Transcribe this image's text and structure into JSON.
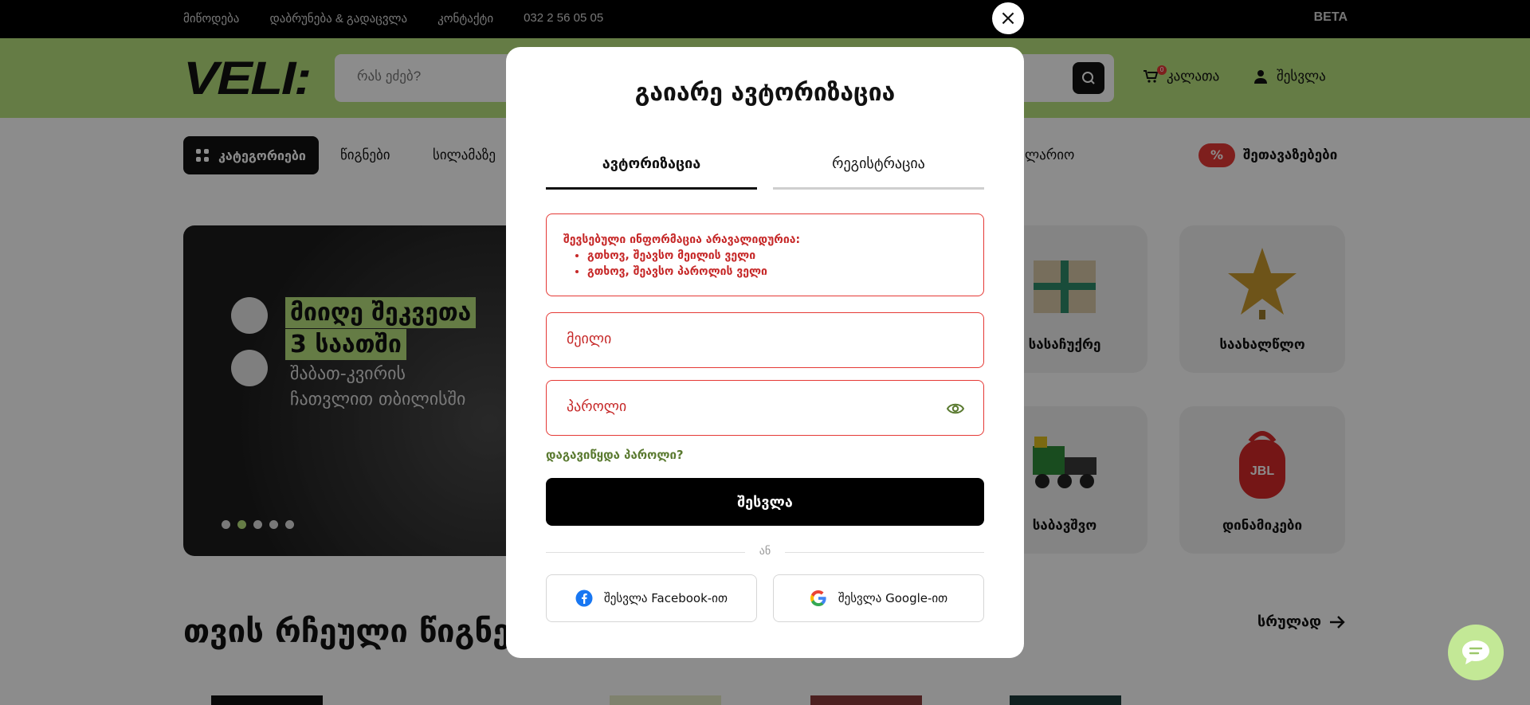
{
  "topbar": {
    "links": [
      "მიწოდება",
      "დაბრუნება & გადაცვლა",
      "კონტაქტი",
      "032 2 56 05 05"
    ],
    "beta": "BETA"
  },
  "header": {
    "logo": "VELI:",
    "search_placeholder": "რას ეძებ?",
    "cart_label": "კალათა",
    "cart_count": "0",
    "login_label": "შესვლა"
  },
  "nav": {
    "categories_label": "კატეგორიები",
    "items": [
      "წიგნები",
      "სილამაზე",
      "ლარიო"
    ],
    "promo_badge": "%",
    "promo_label": "შეთავაზებები"
  },
  "banner": {
    "headline_1": "მიიღე შეკვეთა",
    "headline_2": "3 საათში",
    "sub_1": "შაბათ-კვირის",
    "sub_2": "ჩათვლით თბილისში",
    "slides": 5,
    "active_slide": 2
  },
  "categories": [
    {
      "label": "სასაჩუქრე",
      "icon": "gift-icon"
    },
    {
      "label": "საახალწლო",
      "icon": "star-icon"
    },
    {
      "label": "საბავშვო",
      "icon": "toy-train-icon"
    },
    {
      "label": "დინამიკები",
      "icon": "speaker-icon"
    }
  ],
  "section": {
    "title": "თვის რჩეული წიგნები",
    "see_all": "სრულად"
  },
  "modal": {
    "title": "გაიარე ავტორიზაცია",
    "tabs": [
      "ავტორიზაცია",
      "რეგისტრაცია"
    ],
    "error": {
      "heading": "შევსებული ინფორმაცია არავალიდურია:",
      "items": [
        "გთხოვ, შეავსო მეილის ველი",
        "გთხოვ, შეავსო პაროლის ველი"
      ]
    },
    "email_placeholder": "მეილი",
    "password_placeholder": "პაროლი",
    "forgot_link": "დაგავიწყდა პაროლი?",
    "submit_label": "შესვლა",
    "or_label": "ან",
    "facebook_label": "შესვლა Facebook-ით",
    "google_label": "შესვლა Google-ით",
    "close_symbol": "×"
  },
  "colors": {
    "accent_green": "#b9e27f",
    "error_red": "#e53935",
    "link_green": "#5a7a30"
  }
}
